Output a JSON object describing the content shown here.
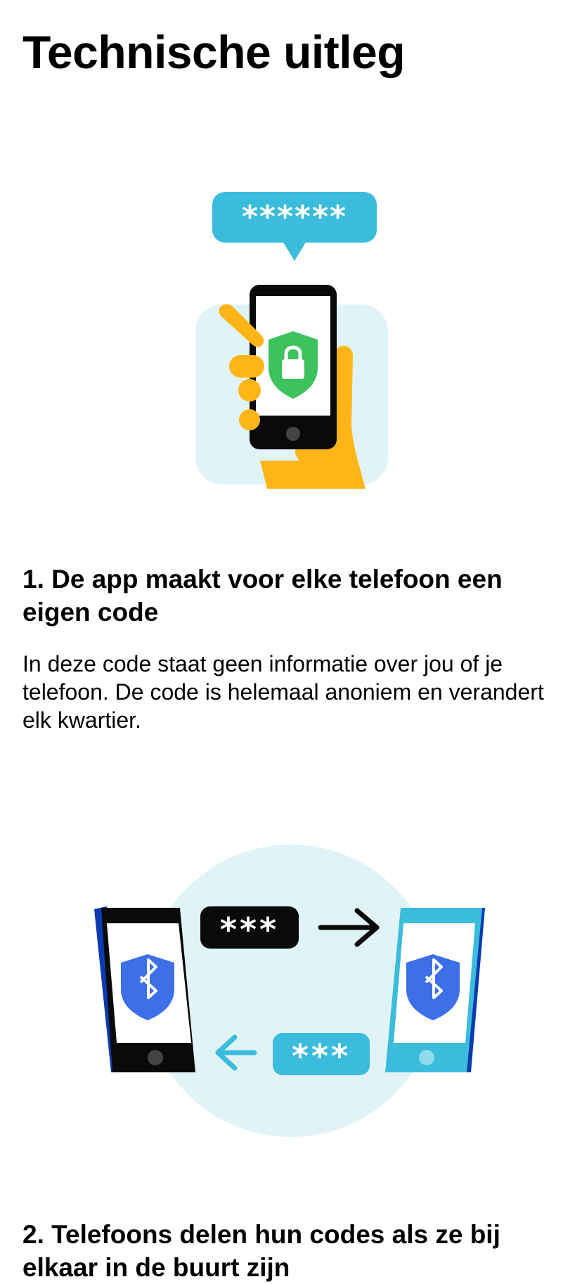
{
  "page": {
    "title": "Technische uitleg"
  },
  "steps": [
    {
      "heading": "1. De app maakt voor elke telefoon een eigen code",
      "body": "In deze code staat geen informatie over jou of je telefoon. De code is helemaal anoniem en verandert elk kwartier.",
      "illustration": {
        "code_bubble": "******",
        "icons": [
          "hand-icon",
          "phone-icon",
          "shield-lock-icon",
          "speech-bubble-icon"
        ]
      }
    },
    {
      "heading": "2. Telefoons delen hun codes als ze bij elkaar in de buurt zijn",
      "illustration": {
        "code_sent": "***",
        "code_received": "***",
        "icons": [
          "phone-icon",
          "bluetooth-shield-icon",
          "arrow-right-icon",
          "arrow-left-icon"
        ]
      }
    }
  ],
  "colors": {
    "light_blue_bg": "#E0F4F7",
    "accent_blue": "#3BBCDC",
    "dark_blue": "#0A3BB1",
    "shield_green": "#3DC25E",
    "bluetooth_blue": "#3C6FE8",
    "hand_yellow": "#FFB517"
  }
}
